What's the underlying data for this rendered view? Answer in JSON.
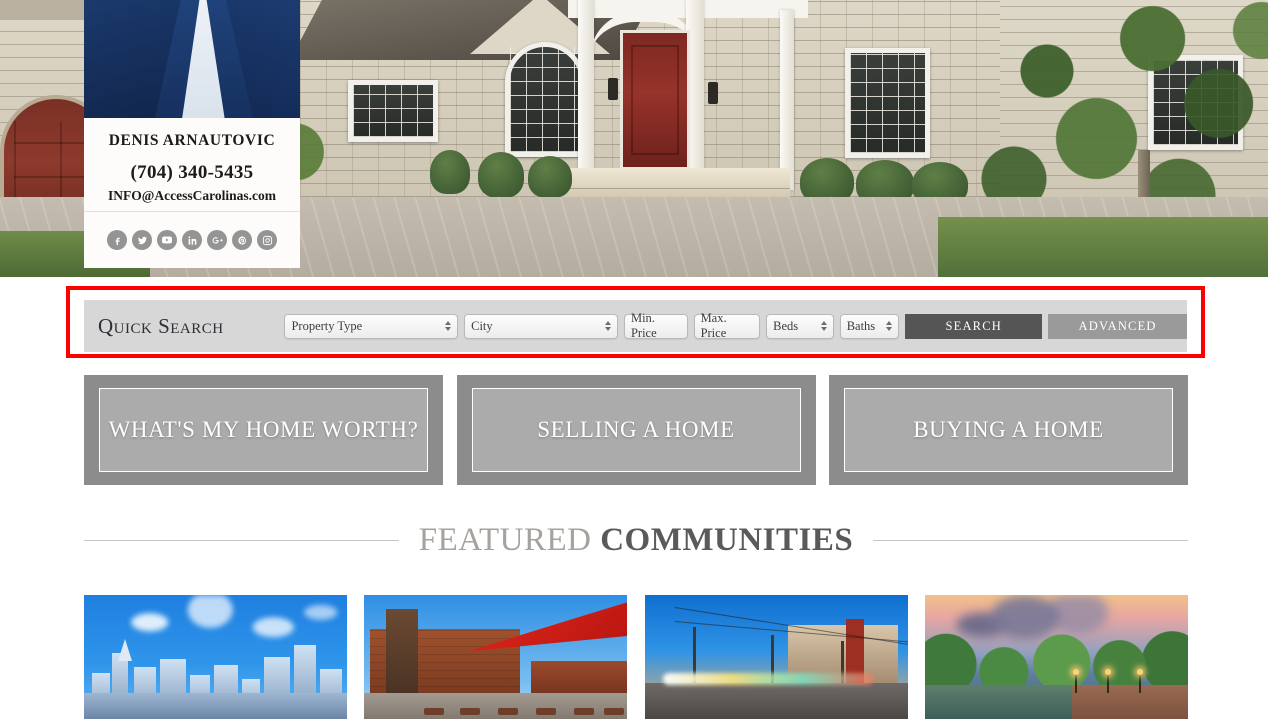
{
  "agent": {
    "name": "DENIS ARNAUTOVIC",
    "phone": "(704) 340-5435",
    "email": "INFO@AccessCarolinas.com",
    "social": [
      {
        "icon": "facebook-icon",
        "label": "f"
      },
      {
        "icon": "twitter-icon",
        "label": "t"
      },
      {
        "icon": "youtube-icon",
        "label": "▶"
      },
      {
        "icon": "linkedin-icon",
        "label": "in"
      },
      {
        "icon": "google-plus-icon",
        "label": "G+"
      },
      {
        "icon": "pinterest-icon",
        "label": "P"
      },
      {
        "icon": "instagram-icon",
        "label": "▢"
      }
    ]
  },
  "quick_search": {
    "title": "Quick Search",
    "property_type": {
      "value": "Property Type"
    },
    "city": {
      "value": "City"
    },
    "min_price": {
      "placeholder": "Min. Price",
      "value": ""
    },
    "max_price": {
      "placeholder": "Max. Price",
      "value": ""
    },
    "beds": {
      "value": "Beds"
    },
    "baths": {
      "value": "Baths"
    },
    "search_label": "SEARCH",
    "advanced_label": "ADVANCED",
    "highlight_color": "#fe0000"
  },
  "cta_panels": [
    {
      "label": "WHAT'S MY HOME WORTH?"
    },
    {
      "label": "SELLING A HOME"
    },
    {
      "label": "BUYING A HOME"
    }
  ],
  "featured": {
    "title_light": "FEATURED",
    "title_dark": "COMMUNITIES"
  },
  "communities": [
    {
      "name": "city-skyline-thumbnail"
    },
    {
      "name": "brick-district-thumbnail"
    },
    {
      "name": "light-rail-thumbnail"
    },
    {
      "name": "park-lake-thumbnail"
    }
  ]
}
